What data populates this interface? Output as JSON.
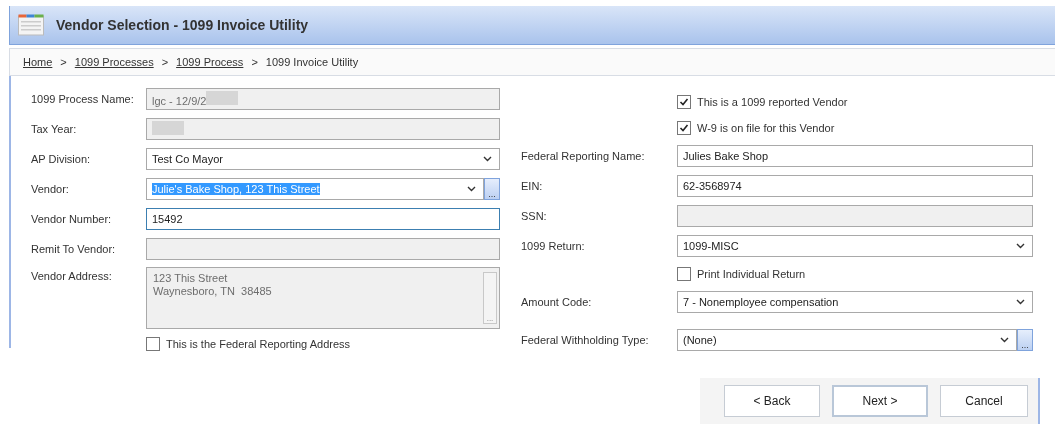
{
  "window": {
    "title": "Vendor Selection - 1099 Invoice Utility"
  },
  "breadcrumb": [
    {
      "kind": "link",
      "text": "Home"
    },
    {
      "kind": "separator",
      "text": ">"
    },
    {
      "kind": "link",
      "text": "1099 Processes"
    },
    {
      "kind": "separator",
      "text": ">"
    },
    {
      "kind": "link",
      "text": "1099 Process"
    },
    {
      "kind": "separator",
      "text": ">"
    },
    {
      "kind": "current",
      "text": "1099 Invoice Utility"
    }
  ],
  "left_fields": [
    {
      "label": "1099 Process Name:",
      "kind": "text",
      "value": "lgc - 12/9/2",
      "readonly": true,
      "redacted": true,
      "focused": false,
      "highlighted": false
    },
    {
      "label": "Tax Year:",
      "kind": "text",
      "readonly": true,
      "redacted": true,
      "focused": false,
      "highlighted": false
    },
    {
      "label": "AP Division:",
      "kind": "select",
      "value": "Test Co Mayor",
      "readonly": false,
      "redacted": false,
      "focused": false,
      "highlighted": false
    },
    {
      "label": "Vendor:",
      "kind": "select",
      "value": "Julie's Bake Shop, 123 This Street",
      "readonly": false,
      "redacted": false,
      "focused": false,
      "highlighted": true,
      "browse_button": "..."
    },
    {
      "label": "Vendor Number:",
      "kind": "text",
      "value": "15492",
      "readonly": false,
      "redacted": false,
      "focused": true,
      "highlighted": false
    },
    {
      "label": "Remit To Vendor:",
      "kind": "text",
      "readonly": true,
      "redacted": false,
      "focused": false,
      "highlighted": false
    },
    {
      "label": "Vendor Address:",
      "kind": "textarea",
      "lines": [
        "123 This Street",
        "Waynesboro, TN  38485"
      ],
      "readonly": true,
      "redacted": false,
      "focused": false,
      "highlighted": false,
      "scroll_button": "..."
    }
  ],
  "address_checkbox": {
    "label": "This is the Federal Reporting Address",
    "checked": false
  },
  "right_fields": [
    {
      "kind": "checkbox",
      "label": "This is a 1099 reported Vendor",
      "checked": true
    },
    {
      "kind": "checkbox",
      "label": "W-9 is on file for this Vendor",
      "checked": true
    },
    {
      "kind": "text",
      "label": "Federal Reporting Name:",
      "value": "Julies Bake Shop",
      "readonly": false
    },
    {
      "kind": "text",
      "label": "EIN:",
      "value": "62-3568974",
      "readonly": false
    },
    {
      "kind": "text",
      "label": "SSN:",
      "readonly": true
    },
    {
      "kind": "select",
      "label": "1099 Return:",
      "value": "1099-MISC",
      "readonly": false
    },
    {
      "kind": "checkbox",
      "label": "Print Individual Return",
      "checked": false
    },
    {
      "kind": "select",
      "label": "Amount Code:",
      "value": "7 - Nonemployee compensation",
      "readonly": false
    },
    {
      "kind": "select",
      "label": "Federal Withholding Type:",
      "value": "(None)",
      "readonly": false,
      "browse_button": "..."
    }
  ],
  "buttons": [
    {
      "label": "< Back",
      "default": false
    },
    {
      "label": "Next >",
      "default": true
    },
    {
      "label": "Cancel",
      "default": false
    }
  ]
}
